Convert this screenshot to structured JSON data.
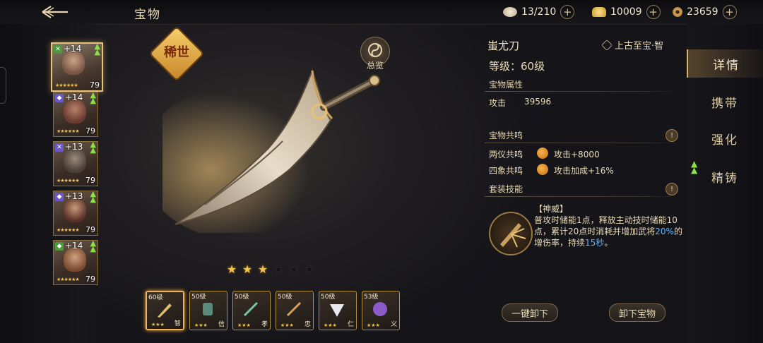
{
  "header": {
    "title": "宝物",
    "resources": [
      {
        "icon": "food-icon",
        "value": "13/210"
      },
      {
        "icon": "gold-ingot-icon",
        "value": "10009"
      },
      {
        "icon": "copper-coin-icon",
        "value": "23659"
      }
    ]
  },
  "heroes": [
    {
      "plus": "+14",
      "level": "79",
      "badge": "green"
    },
    {
      "plus": "+14",
      "level": "79",
      "badge": "purple"
    },
    {
      "plus": "+13",
      "level": "79",
      "badge": "purple"
    },
    {
      "plus": "+13",
      "level": "79",
      "badge": "purple"
    },
    {
      "plus": "+14",
      "level": "79",
      "badge": "green"
    }
  ],
  "treasure": {
    "rarity": "稀世",
    "overview_label": "总览",
    "stars_filled": 3,
    "stars_total": 6,
    "name": "蚩尤刀",
    "tag": "上古至宝·智",
    "level_text": "等级：60级",
    "attr_section": "宝物属性",
    "attr_name": "攻击",
    "attr_value": "39596",
    "resonance_section": "宝物共鸣",
    "resonances": [
      {
        "name": "两仪共鸣",
        "effect": "攻击+8000"
      },
      {
        "name": "四象共鸣",
        "effect": "攻击加成+16%"
      }
    ],
    "set_skill_section": "套装技能",
    "skill_title": "【神威】",
    "skill_desc_1": "普攻时储能1点，释放主动技时储能10点，累计20点时消耗并增加武将",
    "skill_pct": "20%",
    "skill_desc_2": "的增伤率，持续",
    "skill_dur": "15秒",
    "skill_desc_3": "。"
  },
  "slots": [
    {
      "level": "60级",
      "char": "智"
    },
    {
      "level": "50级",
      "char": "信"
    },
    {
      "level": "50级",
      "char": "孝"
    },
    {
      "level": "50级",
      "char": "忠"
    },
    {
      "level": "50级",
      "char": "仁"
    },
    {
      "level": "53级",
      "char": "义"
    }
  ],
  "buttons": {
    "unequip_all": "一键卸下",
    "unequip": "卸下宝物"
  },
  "tabs": [
    "详情",
    "携带",
    "强化",
    "精铸"
  ],
  "colors": {
    "gold": "#f3c34a",
    "highlight": "#5ab4ff",
    "upgrade": "#8be04a"
  }
}
